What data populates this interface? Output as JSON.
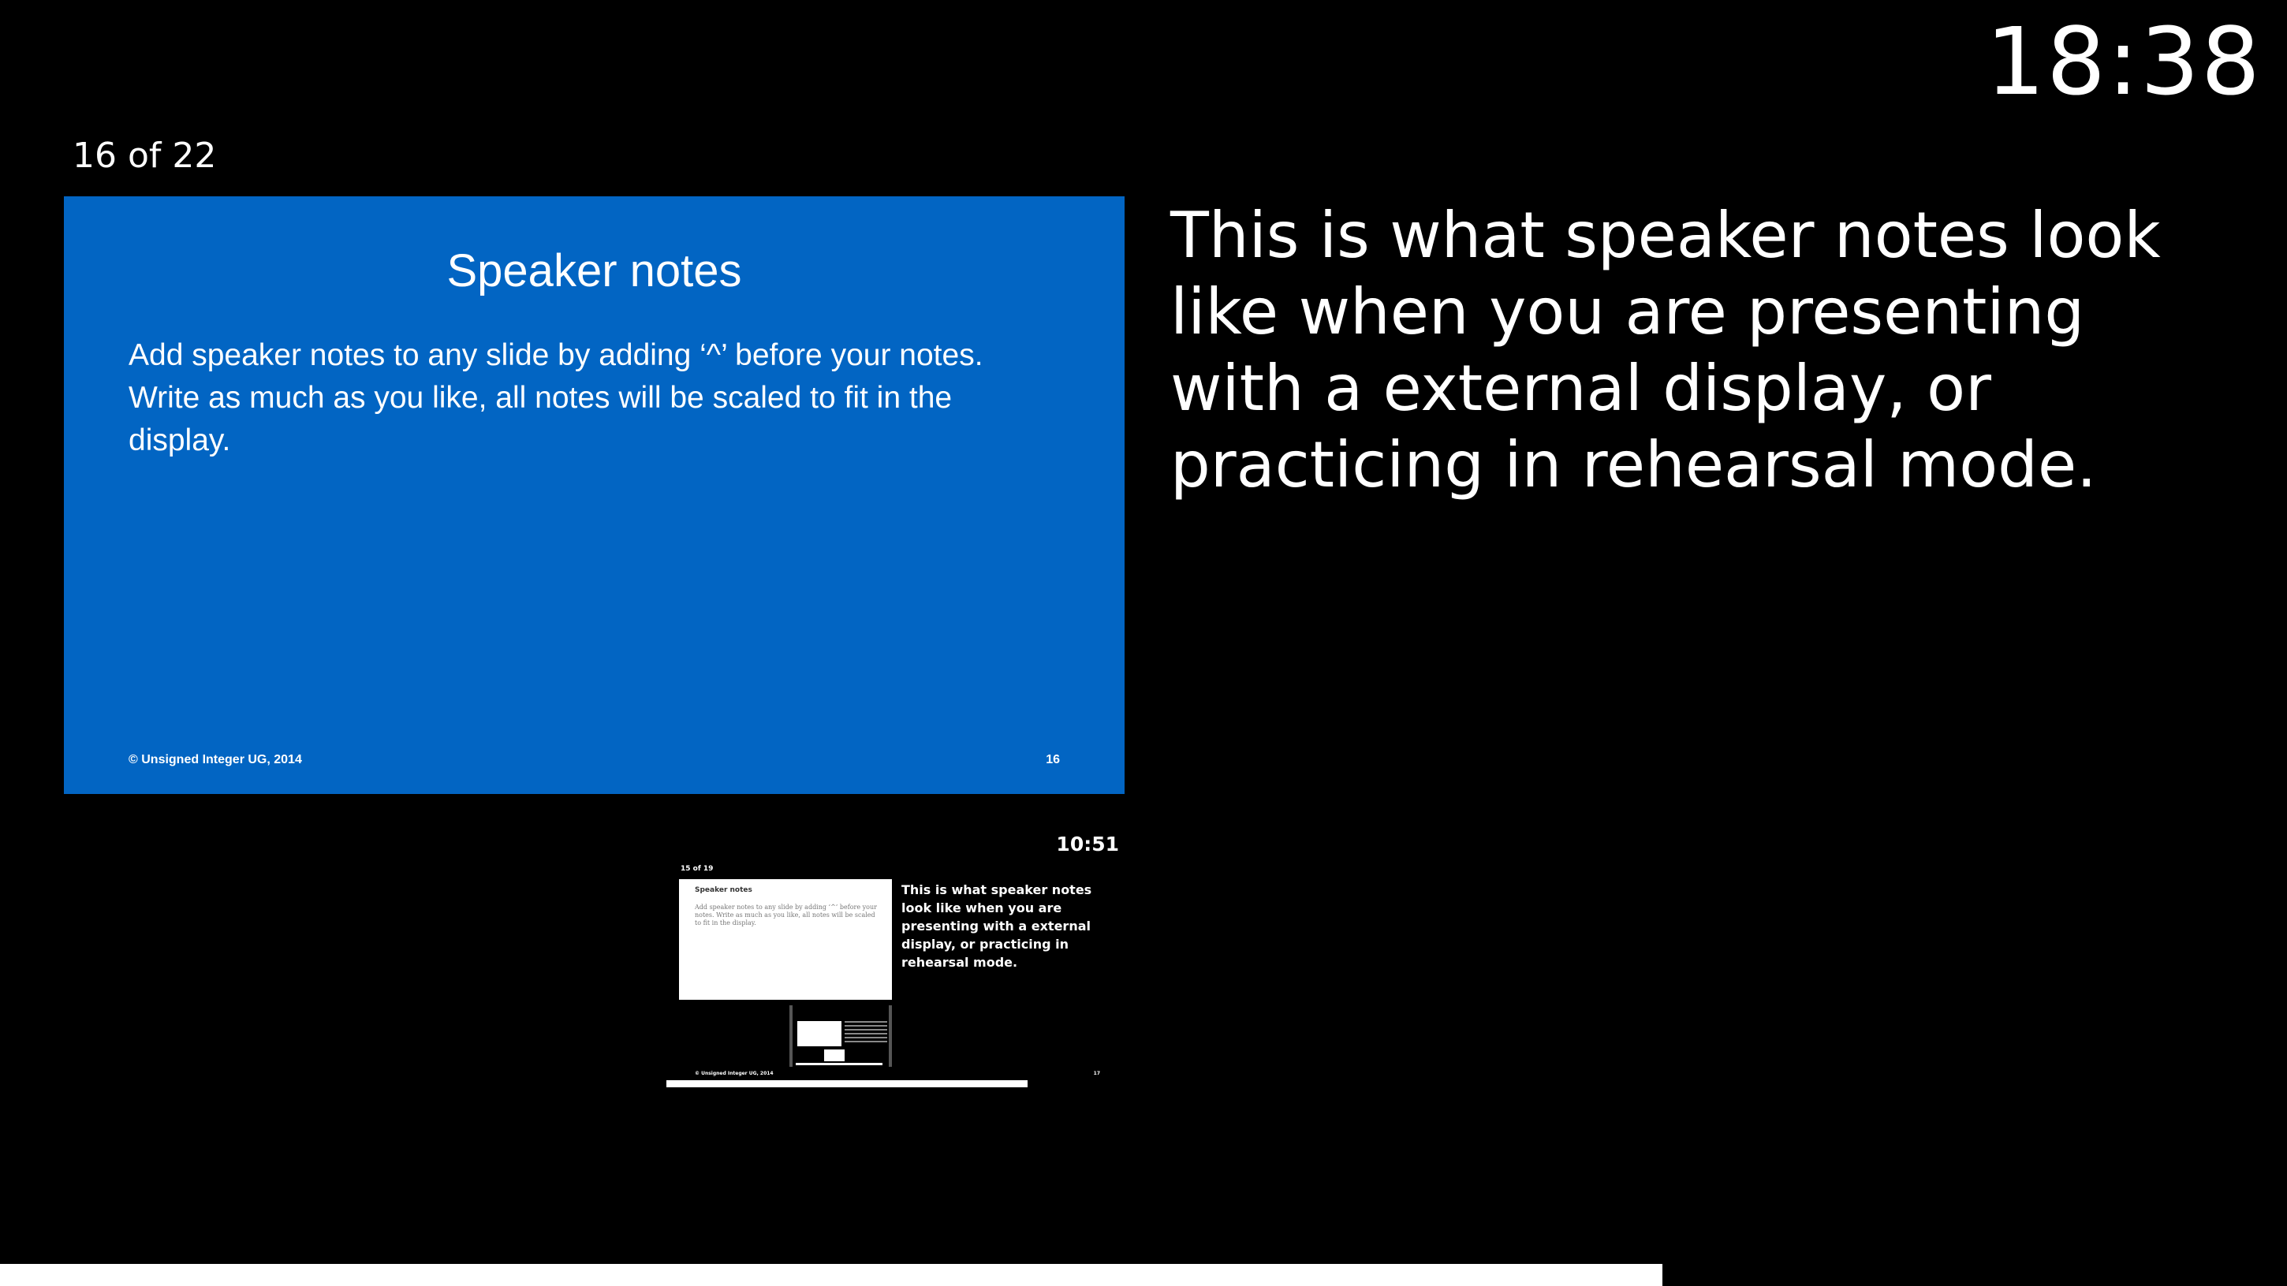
{
  "clock": "18:38",
  "slide_counter": "16 of 22",
  "current_slide": {
    "title": "Speaker notes",
    "body": "Add speaker notes to any slide by adding ‘^’ before your notes. Write as much as you like, all notes will be scaled to fit in the display.",
    "footer_left": "© Unsigned Integer UG, 2014",
    "footer_right": "16",
    "background": "#0265c3"
  },
  "speaker_notes": "This is what speaker notes look like when you are presenting with a external display, or practicing in rehearsal mode.",
  "next_slide": {
    "clock": "10:51",
    "counter": "15 of 19",
    "title": "Speaker notes",
    "body": "Add speaker notes to any slide by adding ‘^’ before your notes. Write as much as you like, all notes will be scaled to fit in the display.",
    "notes": "This is what speaker notes look like when you are presenting with a external display, or practicing in rehearsal mode.",
    "footer_left": "© Unsigned Integer UG, 2014",
    "footer_right": "17",
    "progress": 0.79
  },
  "progress": 0.727
}
